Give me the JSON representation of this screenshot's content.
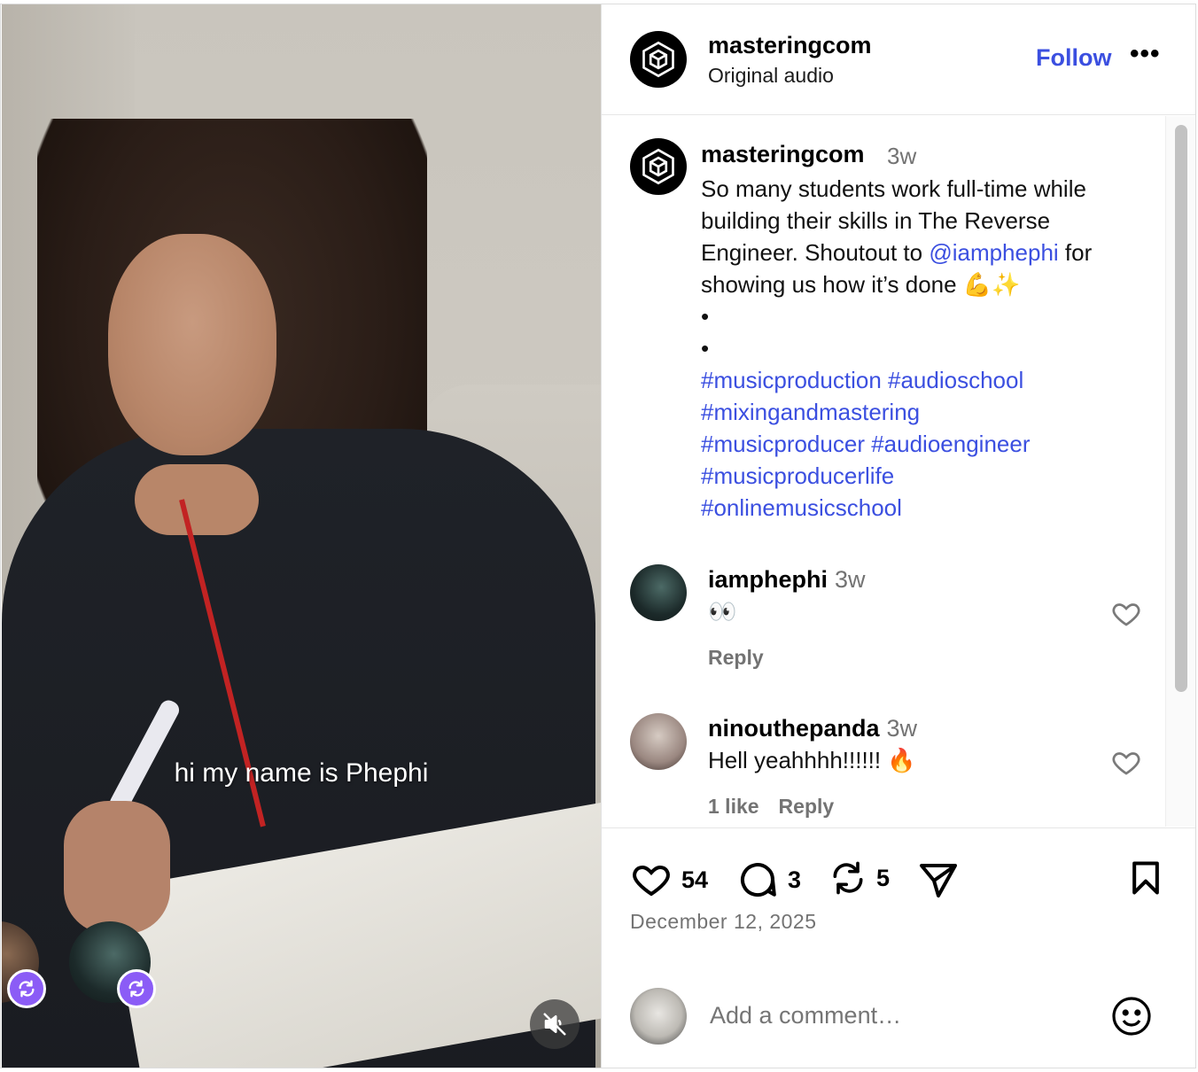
{
  "media": {
    "caption": "hi my name is Phephi"
  },
  "header": {
    "username": "masteringcom",
    "subtitle": "Original audio",
    "follow_label": "Follow",
    "more_label": "•••"
  },
  "post": {
    "username": "masteringcom",
    "time": "3w",
    "text_before": "So many students work full-time while building their skills in The Reverse Engineer. Shoutout to ",
    "mention": "@iamphephi",
    "text_after": " for showing us how it’s done 💪✨",
    "dots": [
      "•",
      "•"
    ],
    "hashtags": [
      "#musicproduction",
      "#audioschool",
      "#mixingandmastering",
      "#musicproducer",
      "#audioengineer",
      "#musicproducerlife",
      "#onlinemusicschool"
    ]
  },
  "comments": [
    {
      "username": "iamphephi",
      "time": "3w",
      "text": "👀",
      "likes": "",
      "reply": "Reply"
    },
    {
      "username": "ninouthepanda",
      "time": "3w",
      "text": "Hell yeahhhh!!!!!! 🔥",
      "likes": "1 like",
      "reply": "Reply"
    }
  ],
  "actions": {
    "likes": "54",
    "comments": "3",
    "reposts": "5",
    "date": "December 12, 2025"
  },
  "add_comment": {
    "placeholder": "Add a comment…"
  },
  "icons": {
    "like": "heart-icon",
    "comment": "comment-bubble-icon",
    "repost": "repost-icon",
    "share": "send-icon",
    "save": "bookmark-icon",
    "emoji": "emoji-icon",
    "mute": "muted-speaker-icon"
  },
  "colors": {
    "link": "#3b4fe0",
    "muted_text": "#737373",
    "repost_badge": "#8b5cf6"
  }
}
